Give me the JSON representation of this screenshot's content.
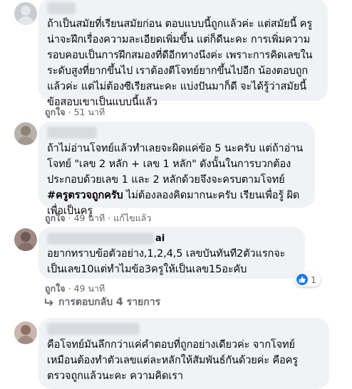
{
  "comments": [
    {
      "text": "ถ้าเป็นสมัยที่เรียนสมัยก่อน ตอบแบบนี้ถูกแล้วค่ะ แต่สมัยนี้ ครูน่าจะฝึกเรื่องความละเอียดเพิ่มขึ้น แต่ก็ดีนะคะ การเพิ่มความรอบคอบเป็นการฝึกสมองที่ดีอีกทางนึงค่ะ เพราะการคิดเลขในระดับสูงที่ยากขึ้นไป เราต้องตีโจทย์ยากขึ้นไปอีก น้องตอบถูกแล้วค่ะ แต่ไม่ต้องซีเรียสนะคะ แบ่งปันมาก็ดี จะได้รู้ว่าสมัยนี้ข้อสอบเขาเป็นแบบนี้แล้ว",
      "like": "ถูกใจ",
      "time": "51 นาที"
    },
    {
      "text_before": "ถ้าไม่อ่านโจทย์แล้วทำเลยจะผิดแค่ข้อ 5 นะครับ แต่ถ้าอ่านโจทย์ \"เลข 2 หลัก + เลข 1 หลัก\" ดังนั้นในการบวกต้องประกอบด้วยเลข 1 และ 2 หลักด้วยจึงจะครบตามโจทย์ ",
      "hashtag": "#ครูตรวจถูกครับ",
      "text_after": " ไม่ต้องลองคิดมากนะครับ เรียนเพื่อรู้ ผิดเพื่อเป็นครู",
      "like": "ถูกใจ",
      "time": "49 นาที",
      "edited": "แก้ไขแล้ว"
    },
    {
      "name_suffix": "ai",
      "text": "อยากทราบข้อตัวอย่าง,1,2,4,5 เลขบันทันที2ตัวแรกจะเป็นเลข10แต่ทำไมข้อ3ครูให้เป็นเลข15อะคับ",
      "like": "ถูกใจ",
      "time": "49 นาที",
      "reaction_count": "1"
    },
    {
      "text": "คือโจทย์มันลึกกว่าแค่คำตอบที่ถูกอย่างเดียวค่ะ จากโจทย์เหมือนต้องทำตัวเลขแต่ละหลักให้สัมพันธ์กันด้วยค่ะ คือครูตรวจถูกแล้วนะคะ ความคิดเรา"
    }
  ],
  "replies_label": "การตอบกลับ 4 รายการ",
  "colors": {
    "bubble": "#f0f2f5",
    "meta": "#65676b",
    "like_blue": "#1877f2"
  }
}
